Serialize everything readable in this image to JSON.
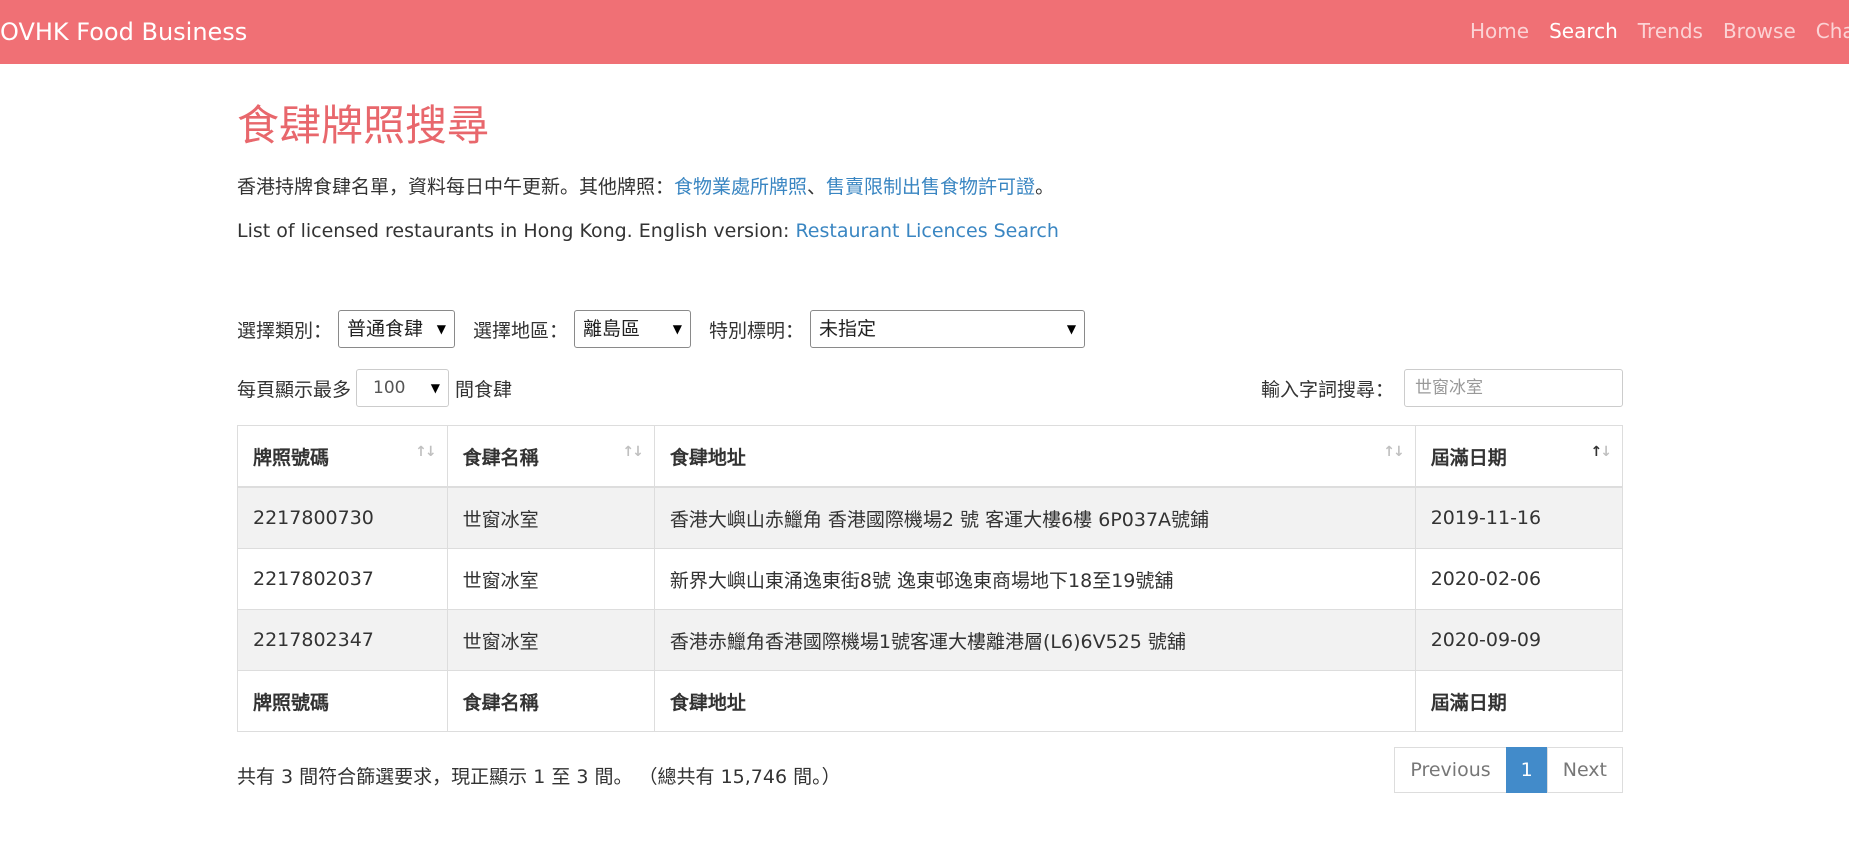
{
  "navbar": {
    "brand": "OVHK Food Business",
    "items": [
      {
        "label": "Home",
        "active": false
      },
      {
        "label": "Search",
        "active": true
      },
      {
        "label": "Trends",
        "active": false
      },
      {
        "label": "Browse",
        "active": false
      },
      {
        "label": "Change",
        "active": false
      }
    ]
  },
  "page": {
    "title": "食肆牌照搜尋",
    "intro_zh": {
      "text": "香港持牌食肆名單，資料每日中午更新。其他牌照：",
      "link1": "食物業處所牌照",
      "sep": "、",
      "link2": "售賣限制出售食物許可證",
      "end": "。"
    },
    "intro_en": {
      "text": "List of licensed restaurants in Hong Kong. English version: ",
      "link": "Restaurant Licences Search"
    }
  },
  "filters": {
    "category_label": "選擇類別：",
    "category_value": "普通食肆",
    "district_label": "選擇地區：",
    "district_value": "離島區",
    "special_label": "特別標明：",
    "special_value": "未指定"
  },
  "length": {
    "prefix": "每頁顯示最多",
    "value": "100",
    "suffix": "間食肆"
  },
  "search": {
    "label": "輸入字詞搜尋：",
    "value": "世窗冰室"
  },
  "table": {
    "headers": [
      "牌照號碼",
      "食肆名稱",
      "食肆地址",
      "屆滿日期"
    ],
    "rows": [
      [
        "2217800730",
        "世窗冰室",
        "香港大嶼山赤鱲角 香港國際機場2 號 客運大樓6樓 6P037A號鋪",
        "2019-11-16"
      ],
      [
        "2217802037",
        "世窗冰室",
        "新界大嶼山東涌逸東街8號 逸東邨逸東商場地下18至19號舖",
        "2020-02-06"
      ],
      [
        "2217802347",
        "世窗冰室",
        "香港赤鱲角香港國際機場1號客運大樓離港層(L6)6V525 號舖",
        "2020-09-09"
      ]
    ],
    "sort_glyph": "↑↓"
  },
  "info": "共有 3 間符合篩選要求，現正顯示 1 至 3 間。 （總共有 15,746 間。）",
  "pagination": {
    "previous": "Previous",
    "current": "1",
    "next": "Next"
  },
  "colors": {
    "navbar": "#f07075",
    "title": "#e8676c",
    "link": "#3a86c2",
    "page_active": "#428bca"
  }
}
